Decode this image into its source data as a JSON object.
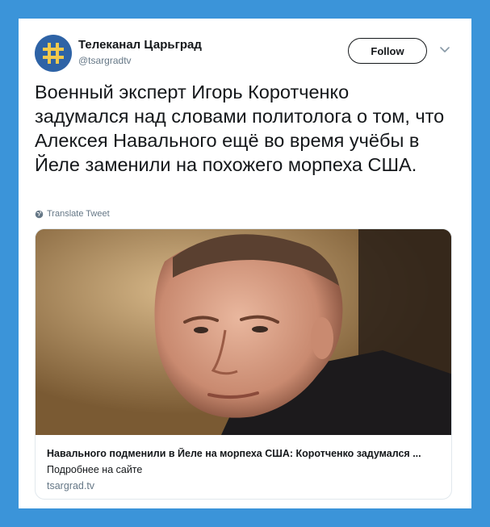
{
  "colors": {
    "page_background": "#3b94d9",
    "card_background": "#ffffff",
    "avatar_background": "#2e63a6",
    "logo_color": "#f2c94c",
    "text_primary": "#14171a",
    "text_secondary": "#657786",
    "border": "#e1e8ed"
  },
  "tweet": {
    "author": {
      "display_name": "Телеканал Царьград",
      "handle": "@tsargradtv",
      "avatar_icon": "orthodox-cross-logo-icon"
    },
    "follow_label": "Follow",
    "more_icon": "chevron-down-icon",
    "text": "Военный эксперт Игорь Коротченко задумался над словами политолога о том, что Алексея Навального ещё во время учёбы в Йеле заменили на похожего морпеха США.",
    "translate_label": "Translate Tweet",
    "translate_icon": "globe-icon",
    "link_card": {
      "image_description_icon": "photo-man-portrait",
      "title": "Навального подменили в Йеле на морпеха США: Коротченко задумался ...",
      "description": "Подробнее на сайте",
      "domain": "tsargrad.tv"
    }
  }
}
